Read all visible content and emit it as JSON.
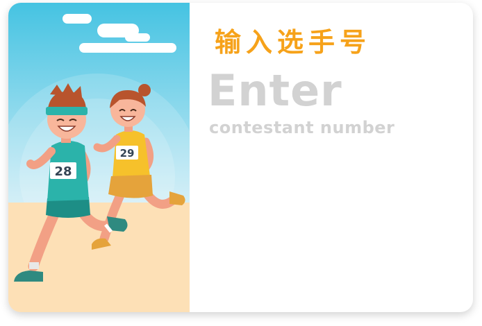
{
  "prompt": {
    "title_cn": "输入选手号",
    "title_en": "Enter",
    "subtitle_en": "contestant number"
  },
  "illustration": {
    "runner_left_bib": "28",
    "runner_right_bib": "29"
  },
  "colors": {
    "accent": "#f6a21a",
    "muted_text": "#d2d2d2",
    "sky_top": "#45c3e2",
    "sky_bottom": "#ccecf6",
    "ground": "#fde0b6"
  }
}
